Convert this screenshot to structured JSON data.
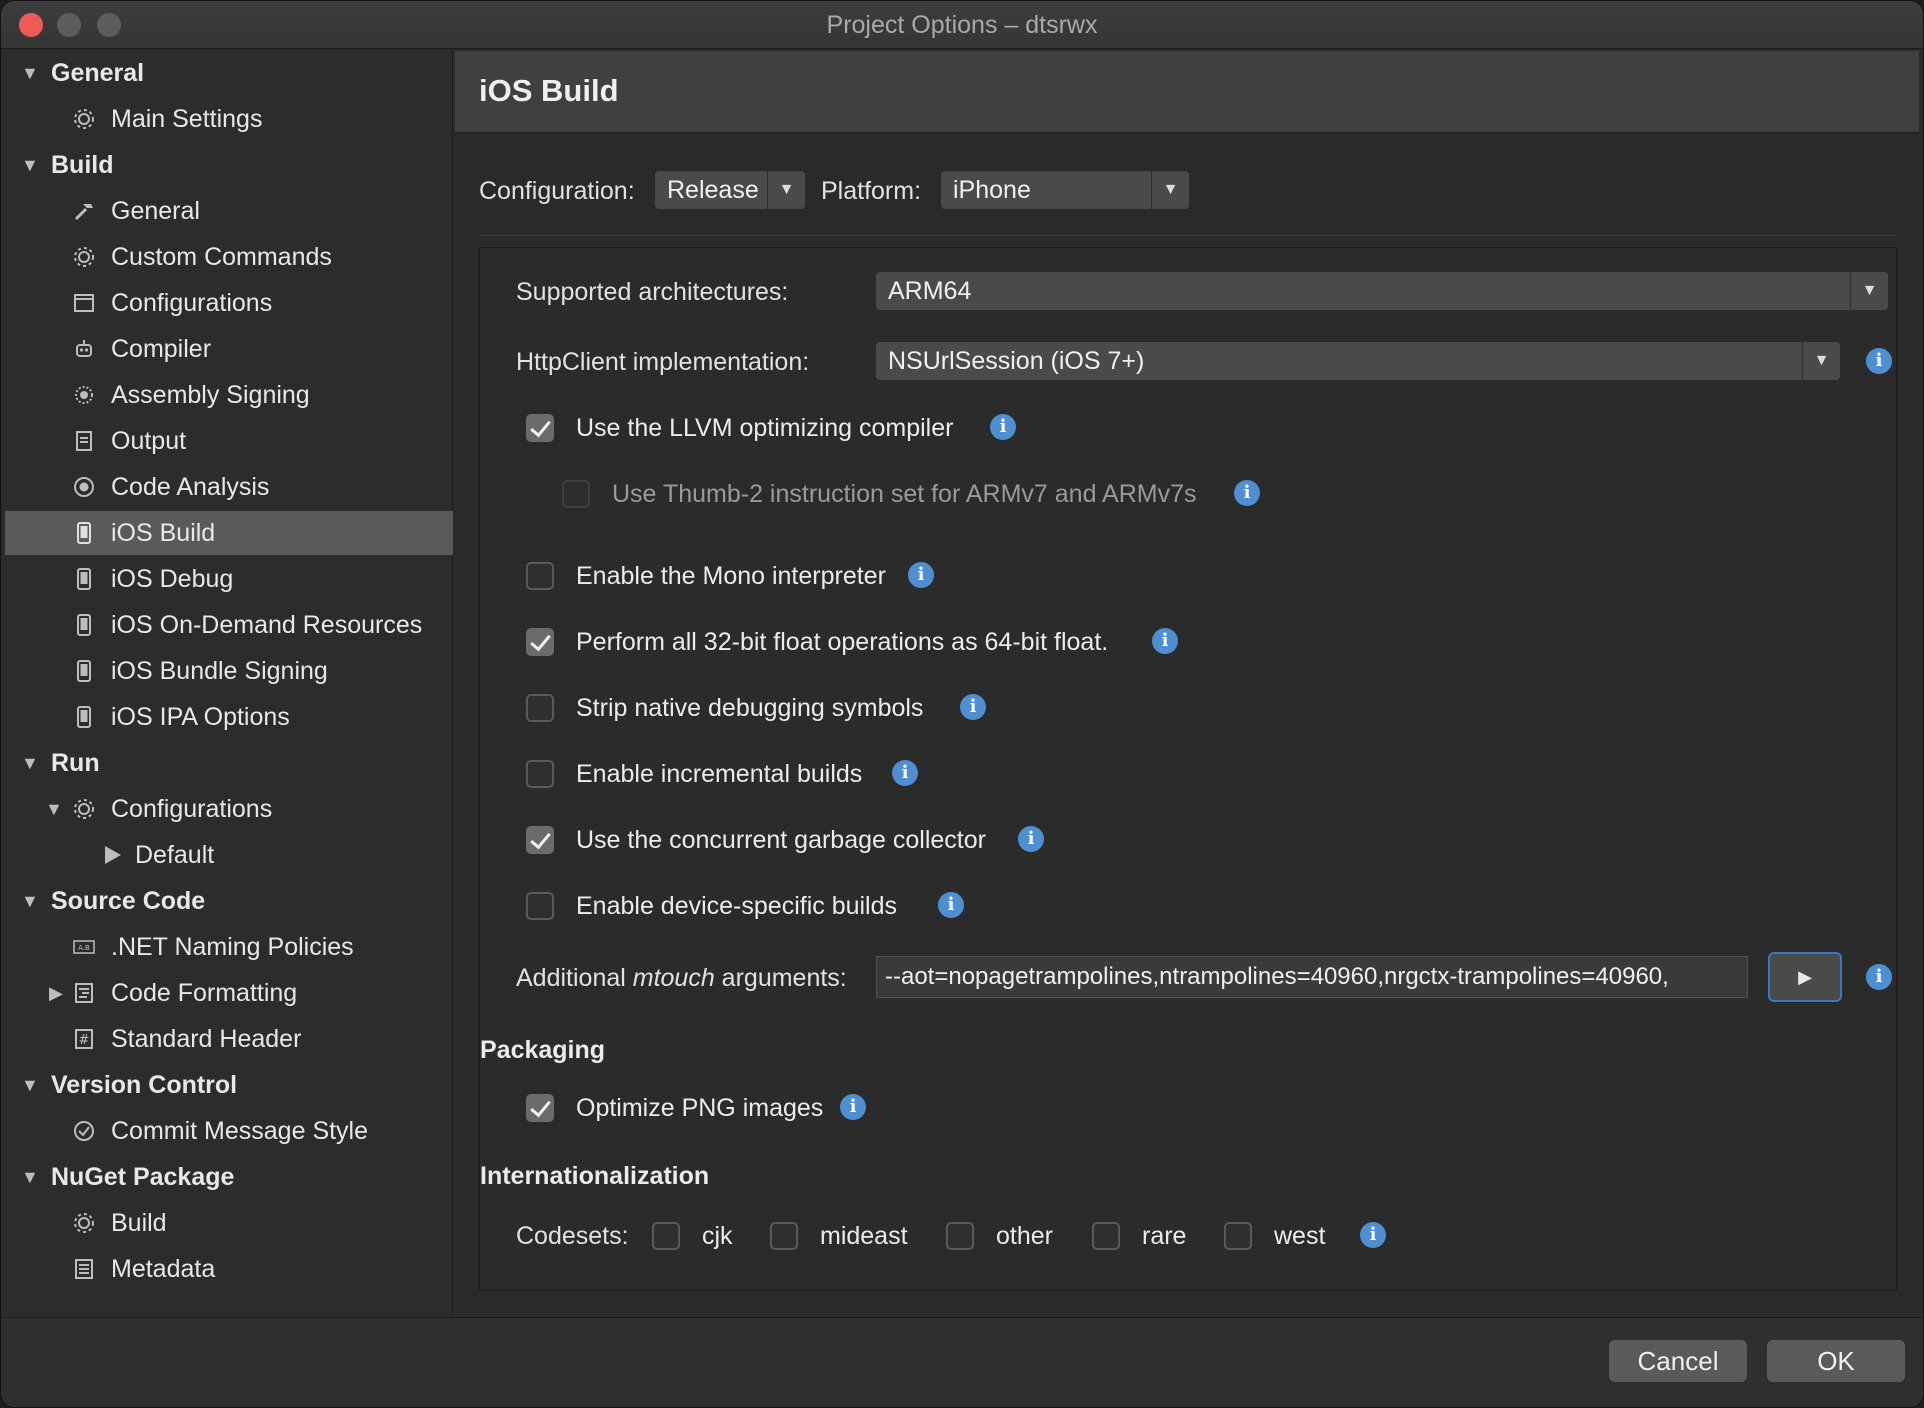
{
  "window": {
    "title": "Project Options – dtsrwx"
  },
  "sidebar": {
    "items": [
      {
        "label": "General",
        "level": 0,
        "expanded": true,
        "section": true
      },
      {
        "label": "Main Settings",
        "level": 1,
        "icon": "gear-icon"
      },
      {
        "label": "Build",
        "level": 0,
        "expanded": true,
        "section": true
      },
      {
        "label": "General",
        "level": 1,
        "icon": "hammer-icon"
      },
      {
        "label": "Custom Commands",
        "level": 1,
        "icon": "gear-icon"
      },
      {
        "label": "Configurations",
        "level": 1,
        "icon": "window-icon"
      },
      {
        "label": "Compiler",
        "level": 1,
        "icon": "robot-icon"
      },
      {
        "label": "Assembly Signing",
        "level": 1,
        "icon": "seal-icon"
      },
      {
        "label": "Output",
        "level": 1,
        "icon": "document-icon"
      },
      {
        "label": "Code Analysis",
        "level": 1,
        "icon": "target-icon"
      },
      {
        "label": "iOS Build",
        "level": 1,
        "icon": "phone-icon",
        "selected": true
      },
      {
        "label": "iOS Debug",
        "level": 1,
        "icon": "phone-icon"
      },
      {
        "label": "iOS On-Demand Resources",
        "level": 1,
        "icon": "phone-icon"
      },
      {
        "label": "iOS Bundle Signing",
        "level": 1,
        "icon": "phone-icon"
      },
      {
        "label": "iOS IPA Options",
        "level": 1,
        "icon": "phone-icon"
      },
      {
        "label": "Run",
        "level": 0,
        "expanded": true,
        "section": true
      },
      {
        "label": "Configurations",
        "level": 1,
        "icon": "gear-icon",
        "expanded": true
      },
      {
        "label": "Default",
        "level": 2,
        "icon": "play-icon"
      },
      {
        "label": "Source Code",
        "level": 0,
        "expanded": true,
        "section": true
      },
      {
        "label": ".NET Naming Policies",
        "level": 1,
        "icon": "ab-icon"
      },
      {
        "label": "Code Formatting",
        "level": 1,
        "icon": "format-icon",
        "collapsed": true
      },
      {
        "label": "Standard Header",
        "level": 1,
        "icon": "hash-icon"
      },
      {
        "label": "Version Control",
        "level": 0,
        "expanded": true,
        "section": true
      },
      {
        "label": "Commit Message Style",
        "level": 1,
        "icon": "check-circle-icon"
      },
      {
        "label": "NuGet Package",
        "level": 0,
        "expanded": true,
        "section": true
      },
      {
        "label": "Build",
        "level": 1,
        "icon": "gear-icon"
      },
      {
        "label": "Metadata",
        "level": 1,
        "icon": "list-icon"
      }
    ]
  },
  "main": {
    "title": "iOS Build",
    "configuration_label": "Configuration:",
    "configuration_value": "Release",
    "platform_label": "Platform:",
    "platform_value": "iPhone",
    "arch_label": "Supported architectures:",
    "arch_value": "ARM64",
    "http_label": "HttpClient implementation:",
    "http_value": "NSUrlSession (iOS 7+)",
    "options": [
      {
        "label": "Use the LLVM optimizing compiler",
        "checked": true
      },
      {
        "label": "Use Thumb-2 instruction set for ARMv7 and ARMv7s",
        "checked": false,
        "disabled": true
      },
      {
        "label": "Enable the Mono interpreter",
        "checked": false
      },
      {
        "label": "Perform all 32-bit float operations as 64-bit float.",
        "checked": true
      },
      {
        "label": "Strip native debugging symbols",
        "checked": false
      },
      {
        "label": "Enable incremental builds",
        "checked": false
      },
      {
        "label": "Use the concurrent garbage collector",
        "checked": true
      },
      {
        "label": "Enable device-specific builds",
        "checked": false
      }
    ],
    "mtouch_label_prefix": "Additional ",
    "mtouch_label_em": "mtouch",
    "mtouch_label_suffix": " arguments:",
    "mtouch_value": "--aot=nopagetrampolines,ntrampolines=40960,nrgctx-trampolines=40960,",
    "run_glyph": "▶",
    "packaging_title": "Packaging",
    "optimize_png_label": "Optimize PNG images",
    "optimize_png_checked": true,
    "i18n_title": "Internationalization",
    "codesets_label": "Codesets:",
    "codesets": [
      {
        "label": "cjk",
        "checked": false
      },
      {
        "label": "mideast",
        "checked": false
      },
      {
        "label": "other",
        "checked": false
      },
      {
        "label": "rare",
        "checked": false
      },
      {
        "label": "west",
        "checked": false
      }
    ],
    "info_glyph": "i"
  },
  "footer": {
    "cancel_label": "Cancel",
    "ok_label": "OK"
  },
  "colors": {
    "accent": "#4f8ed0",
    "selection": "#5a5a5a",
    "focus": "#3a78c2"
  }
}
